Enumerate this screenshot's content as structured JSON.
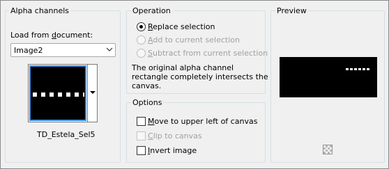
{
  "alpha": {
    "title": "Alpha channels",
    "load_from_document_label_pre": "Load from ",
    "load_from_document_label_u": "d",
    "load_from_document_label_post": "ocument:",
    "document_value": "Image2",
    "thumbnail_caption": "TD_Estela_Sel5"
  },
  "operation": {
    "title": "Operation",
    "options": [
      {
        "pre": "",
        "u": "R",
        "post": "eplace selection",
        "checked": true,
        "enabled": true
      },
      {
        "pre": "",
        "u": "A",
        "post": "dd to current selection",
        "checked": false,
        "enabled": false
      },
      {
        "pre": "",
        "u": "S",
        "post": "ubtract from current selection",
        "checked": false,
        "enabled": false
      }
    ],
    "note_line1": "The original alpha channel",
    "note_line2": "rectangle completely intersects the",
    "note_line3": "canvas."
  },
  "options": {
    "title": "Options",
    "items": [
      {
        "pre": "",
        "u": "M",
        "post": "ove to upper left of canvas",
        "checked": false,
        "enabled": true
      },
      {
        "pre": "",
        "u": "C",
        "post": "lip to canvas",
        "checked": false,
        "enabled": false
      },
      {
        "pre": "",
        "u": "I",
        "post": "nvert image",
        "checked": false,
        "enabled": true
      }
    ]
  },
  "preview": {
    "title": "Preview"
  }
}
